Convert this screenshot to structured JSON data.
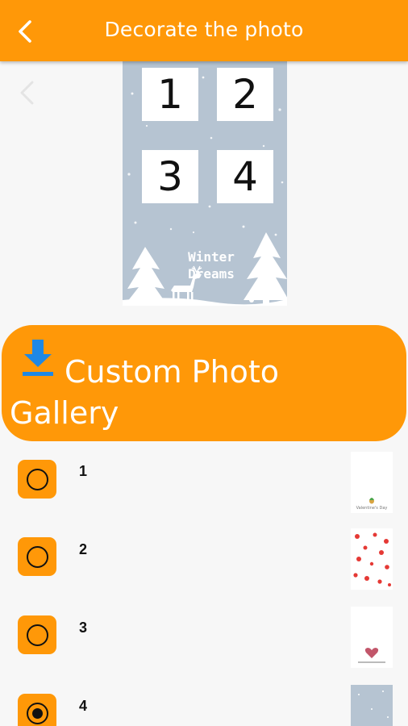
{
  "header": {
    "title": "Decorate the photo",
    "back_icon": "chevron-left-icon",
    "background": "#ff9808"
  },
  "preview": {
    "slots": [
      "1",
      "2",
      "3",
      "4"
    ],
    "caption_line1": "Winter",
    "caption_line2": "Dreams",
    "background": "#b6c4d2"
  },
  "gallery_button": {
    "label": "Custom Photo Gallery",
    "icon": "download-icon"
  },
  "options": [
    {
      "label": "1",
      "selected": false,
      "thumb_text": "Valentine's Day"
    },
    {
      "label": "2",
      "selected": false,
      "thumb_text": ""
    },
    {
      "label": "3",
      "selected": false,
      "thumb_text": ""
    },
    {
      "label": "4",
      "selected": true,
      "thumb_text": ""
    }
  ],
  "accent_color": "#ff9808"
}
